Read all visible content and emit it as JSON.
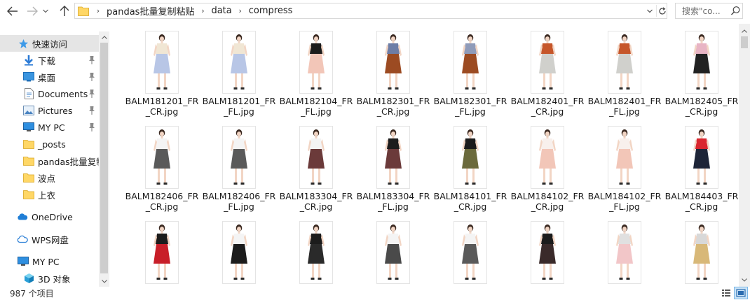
{
  "address": {
    "crumbs": [
      "pandas批量复制粘贴",
      "data",
      "compress"
    ],
    "search_placeholder": "搜索\"co..."
  },
  "sidebar": {
    "items": [
      {
        "label": "快速访问",
        "icon": "star-icon",
        "pinned": false,
        "selected": true
      },
      {
        "label": "下载",
        "icon": "download-icon",
        "pinned": true,
        "selected": false
      },
      {
        "label": "桌面",
        "icon": "desktop-icon",
        "pinned": true,
        "selected": false
      },
      {
        "label": "Documents",
        "icon": "document-icon",
        "pinned": true,
        "selected": false
      },
      {
        "label": "Pictures",
        "icon": "pictures-icon",
        "pinned": true,
        "selected": false
      },
      {
        "label": "MY PC",
        "icon": "computer-icon",
        "pinned": true,
        "selected": false
      },
      {
        "label": "_posts",
        "icon": "folder-icon",
        "pinned": false,
        "selected": false
      },
      {
        "label": "pandas批量复制",
        "icon": "folder-icon",
        "pinned": false,
        "selected": false
      },
      {
        "label": "波点",
        "icon": "folder-icon",
        "pinned": false,
        "selected": false
      },
      {
        "label": "上衣",
        "icon": "folder-icon",
        "pinned": false,
        "selected": false
      },
      {
        "label": "OneDrive",
        "icon": "cloud-icon",
        "pinned": false,
        "selected": false
      },
      {
        "label": "WPS网盘",
        "icon": "wps-cloud-icon",
        "pinned": false,
        "selected": false
      },
      {
        "label": "MY PC",
        "icon": "computer-icon",
        "pinned": false,
        "selected": false
      },
      {
        "label": "3D 对象",
        "icon": "3d-objects-icon",
        "pinned": false,
        "selected": false
      }
    ]
  },
  "files": [
    {
      "name": "BALM181201_FR_CR.jpg",
      "top": "#f0e6d4",
      "bottom": "#b8c6e6"
    },
    {
      "name": "BALM181201_FR_FL.jpg",
      "top": "#f0e6d4",
      "bottom": "#b8c6e6"
    },
    {
      "name": "BALM182104_FR_FL.jpg",
      "top": "#1c1c1c",
      "bottom": "#f2c6b8"
    },
    {
      "name": "BALM182301_FR_CR.jpg",
      "top": "#6d7da6",
      "bottom": "#9c4b22"
    },
    {
      "name": "BALM182301_FR_FL.jpg",
      "top": "#8f9bb9",
      "bottom": "#9c4b22"
    },
    {
      "name": "BALM182401_FR_CR.jpg",
      "top": "#c6562a",
      "bottom": "#d0d0cc"
    },
    {
      "name": "BALM182401_FR_FL.jpg",
      "top": "#c6562a",
      "bottom": "#d0d0cc"
    },
    {
      "name": "BALM182405_FR_CR.jpg",
      "top": "#e8b4c4",
      "bottom": "#222222"
    },
    {
      "name": "BALM182406_FR_CR.jpg",
      "top": "#f4f4f4",
      "bottom": "#5a5a5a"
    },
    {
      "name": "BALM182406_FR_FL.jpg",
      "top": "#f4f4f4",
      "bottom": "#5a5a5a"
    },
    {
      "name": "BALM183304_FR_CR.jpg",
      "top": "#f4f4f4",
      "bottom": "#6b3a3a"
    },
    {
      "name": "BALM183304_FR_FL.jpg",
      "top": "#1c1c1c",
      "bottom": "#6b3a3a"
    },
    {
      "name": "BALM184101_FR_CR.jpg",
      "top": "#1c1c1c",
      "bottom": "#6b6a3c"
    },
    {
      "name": "BALM184102_FR_CR.jpg",
      "top": "#f8f0ec",
      "bottom": "#f2c6b8"
    },
    {
      "name": "BALM184102_FR_FL.jpg",
      "top": "#f8f0ec",
      "bottom": "#f2c6b8"
    },
    {
      "name": "BALM184403_FR_CR.jpg",
      "top": "#d9262e",
      "bottom": "#1e2538"
    },
    {
      "name": "",
      "top": "#1c1c1c",
      "bottom": "#c81e28"
    },
    {
      "name": "",
      "top": "#f4f4f4",
      "bottom": "#1c1c1c"
    },
    {
      "name": "",
      "top": "#1c1c1c",
      "bottom": "#2a2a2a"
    },
    {
      "name": "",
      "top": "#f4f4f4",
      "bottom": "#4a4a4a"
    },
    {
      "name": "",
      "top": "#f4f4f4",
      "bottom": "#5a5a5a"
    },
    {
      "name": "",
      "top": "#1c1c1c",
      "bottom": "#3a2a2a"
    },
    {
      "name": "",
      "top": "#e0e0e0",
      "bottom": "#f2c6c8"
    },
    {
      "name": "",
      "top": "#d8d8d8",
      "bottom": "#d8b878"
    }
  ],
  "status": {
    "item_count": "987 个项目"
  },
  "colors": {
    "accent": "#0078d7",
    "folder": "#ffd766",
    "selected_nav": "#e5e5e5"
  }
}
